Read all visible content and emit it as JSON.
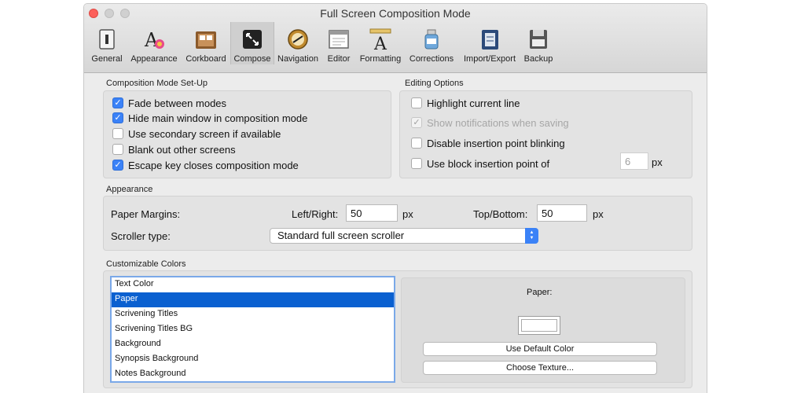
{
  "window": {
    "title": "Full Screen Composition Mode"
  },
  "toolbar": {
    "items": [
      {
        "label": "General",
        "icon": "general-switch-icon"
      },
      {
        "label": "Appearance",
        "icon": "appearance-icon"
      },
      {
        "label": "Corkboard",
        "icon": "corkboard-icon"
      },
      {
        "label": "Compose",
        "icon": "compose-icon"
      },
      {
        "label": "Navigation",
        "icon": "navigation-compass-icon"
      },
      {
        "label": "Editor",
        "icon": "editor-window-icon"
      },
      {
        "label": "Formatting",
        "icon": "formatting-ruler-icon"
      },
      {
        "label": "Corrections",
        "icon": "corrections-bottle-icon"
      },
      {
        "label": "Import/Export",
        "icon": "import-export-binder-icon"
      },
      {
        "label": "Backup",
        "icon": "backup-icon"
      }
    ],
    "active": "Compose"
  },
  "composition": {
    "heading": "Composition Mode Set-Up",
    "options": [
      {
        "label": "Fade between modes",
        "checked": true
      },
      {
        "label": "Hide main window in composition mode",
        "checked": true
      },
      {
        "label": "Use secondary screen if available",
        "checked": false
      },
      {
        "label": "Blank out other screens",
        "checked": false
      },
      {
        "label": "Escape key closes composition mode",
        "checked": true
      }
    ]
  },
  "editing": {
    "heading": "Editing Options",
    "highlight": "Highlight current line",
    "notifications": "Show notifications when saving",
    "blinking": "Disable insertion point blinking",
    "block": "Use block insertion point of",
    "block_value": "6",
    "block_unit": "px"
  },
  "appearance": {
    "heading": "Appearance",
    "paper_margins": "Paper Margins:",
    "left_right": "Left/Right:",
    "left_right_value": "50",
    "left_right_unit": "px",
    "top_bottom": "Top/Bottom:",
    "top_bottom_value": "50",
    "top_bottom_unit": "px",
    "scroller_label": "Scroller type:",
    "scroller_value": "Standard full screen scroller"
  },
  "colors": {
    "heading": "Customizable Colors",
    "items": [
      "Text Color",
      "Paper",
      "Scrivening Titles",
      "Scrivening Titles BG",
      "Background",
      "Synopsis Background",
      "Notes Background"
    ],
    "selected": "Paper",
    "detail_title": "Paper:",
    "default_button": "Use Default Color",
    "texture_button": "Choose Texture...",
    "swatch_color": "#ffffff"
  },
  "colors_theme": {
    "accent": "#3b82f7",
    "selection": "#0a60d0"
  }
}
